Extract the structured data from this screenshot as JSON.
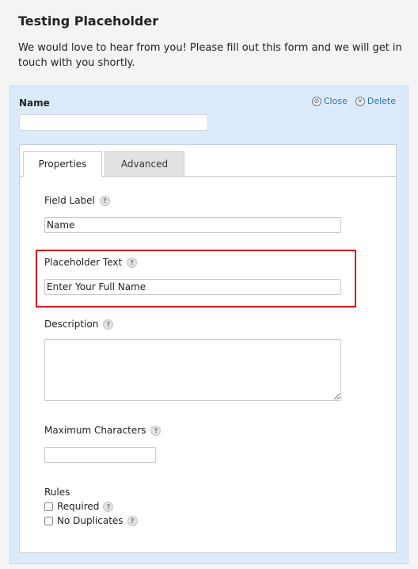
{
  "form": {
    "title": "Testing Placeholder",
    "description": "We would love to hear from you! Please fill out this form and we will get in touch with you shortly."
  },
  "field": {
    "name": "Name",
    "close_label": "Close",
    "delete_label": "Delete"
  },
  "tabs": [
    {
      "label": "Properties",
      "active": true
    },
    {
      "label": "Advanced",
      "active": false
    }
  ],
  "properties": {
    "field_label": {
      "label": "Field Label",
      "value": "Name"
    },
    "placeholder_text": {
      "label": "Placeholder Text",
      "value": "Enter Your Full Name"
    },
    "description": {
      "label": "Description",
      "value": ""
    },
    "maximum_characters": {
      "label": "Maximum Characters",
      "value": ""
    },
    "rules": {
      "label": "Rules",
      "required": {
        "label": "Required",
        "checked": false
      },
      "no_duplicates": {
        "label": "No Duplicates",
        "checked": false
      }
    }
  },
  "colors": {
    "panel_bg": "#dcebfc",
    "highlight": "#d8131b",
    "link": "#2a6fb8"
  }
}
